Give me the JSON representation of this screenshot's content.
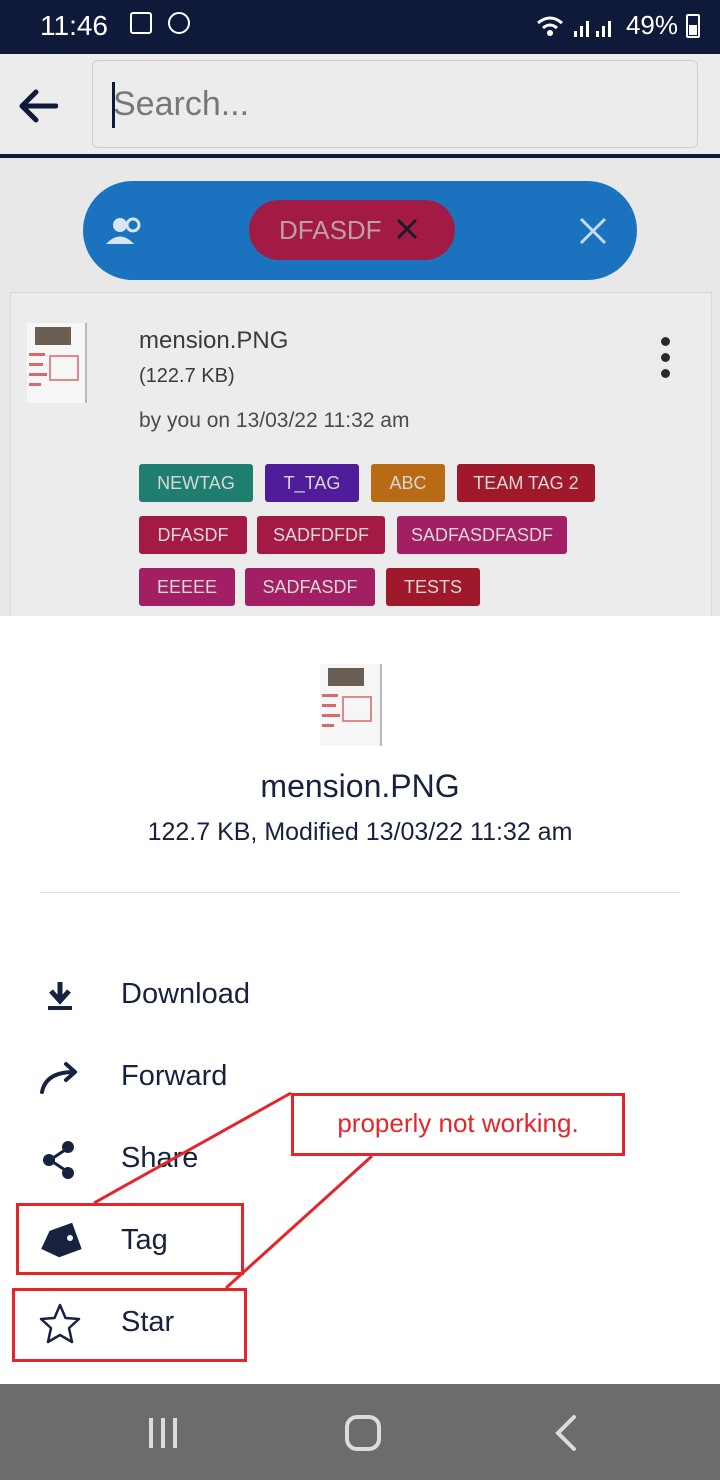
{
  "status_bar": {
    "time": "11:46",
    "battery": "49%"
  },
  "search": {
    "placeholder": "Search..."
  },
  "filter": {
    "chip_label": "DFASDF"
  },
  "file_card": {
    "name": "mension.PNG",
    "size": "(122.7 KB)",
    "owner_line": "by you on  13/03/22   11:32 am",
    "tags": [
      {
        "label": "NEWTAG",
        "color": "#1e7e70"
      },
      {
        "label": "T_TAG",
        "color": "#4f1c9a"
      },
      {
        "label": "ABC",
        "color": "#b96a14"
      },
      {
        "label": "TEAM TAG 2",
        "color": "#a0192b"
      },
      {
        "label": "DFASDF",
        "color": "#a31b44"
      },
      {
        "label": "SADFDFDF",
        "color": "#a31b44"
      },
      {
        "label": "SADFASDFASDF",
        "color": "#a21f63"
      },
      {
        "label": "EEEEE",
        "color": "#a21f63"
      },
      {
        "label": "SADFASDF",
        "color": "#a21f63"
      },
      {
        "label": "TESTS",
        "color": "#a0192b"
      }
    ]
  },
  "sheet": {
    "file_name": "mension.PNG",
    "file_meta": "122.7 KB, Modified 13/03/22   11:32 am",
    "actions": [
      {
        "label": "Download",
        "icon": "download-icon"
      },
      {
        "label": "Forward",
        "icon": "forward-icon"
      },
      {
        "label": "Share",
        "icon": "share-icon"
      },
      {
        "label": "Tag",
        "icon": "tag-icon"
      },
      {
        "label": "Star",
        "icon": "star-icon"
      }
    ]
  },
  "annotation": {
    "text": "properly not working."
  },
  "colors": {
    "navy": "#0f1a3a",
    "filter_blue": "#1b73c0",
    "annotation_red": "#e3262a"
  }
}
